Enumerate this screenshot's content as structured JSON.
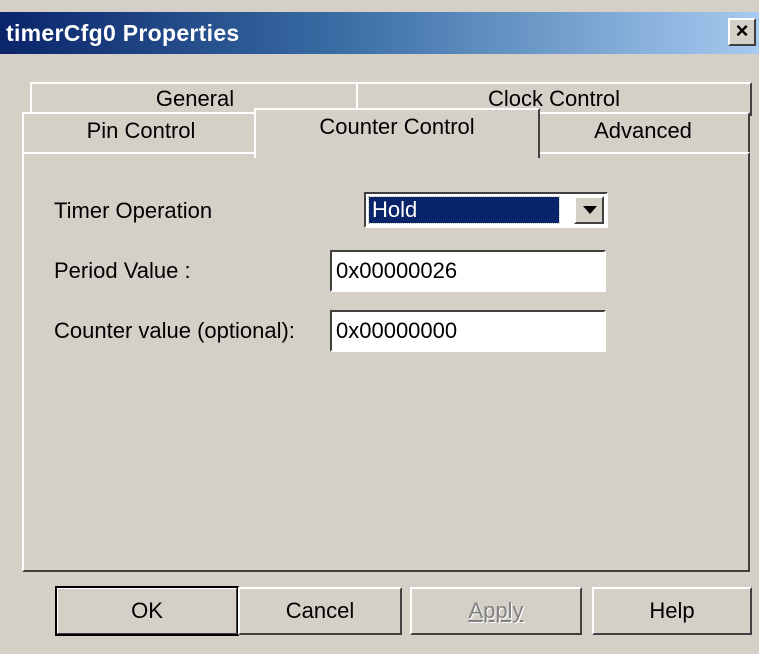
{
  "window": {
    "title": "timerCfg0 Properties",
    "close_label": "×"
  },
  "tabs": {
    "row_back": [
      {
        "label": "General"
      },
      {
        "label": "Clock Control"
      }
    ],
    "row_front": [
      {
        "label": "Pin Control"
      },
      {
        "label": "Counter Control",
        "active": true
      },
      {
        "label": "Advanced"
      }
    ]
  },
  "form": {
    "timer_operation_label": "Timer Operation",
    "timer_operation_value": "Hold",
    "period_label": "Period Value :",
    "period_value": "0x00000026",
    "counter_label": "Counter value (optional):",
    "counter_value": "0x00000000"
  },
  "buttons": {
    "ok": "OK",
    "cancel": "Cancel",
    "apply": "Apply",
    "help": "Help"
  },
  "colors": {
    "title_bar_start": "#0a246a",
    "title_bar_end": "#a6caf0",
    "face": "#d4d0c8",
    "selection": "#0a246a"
  }
}
